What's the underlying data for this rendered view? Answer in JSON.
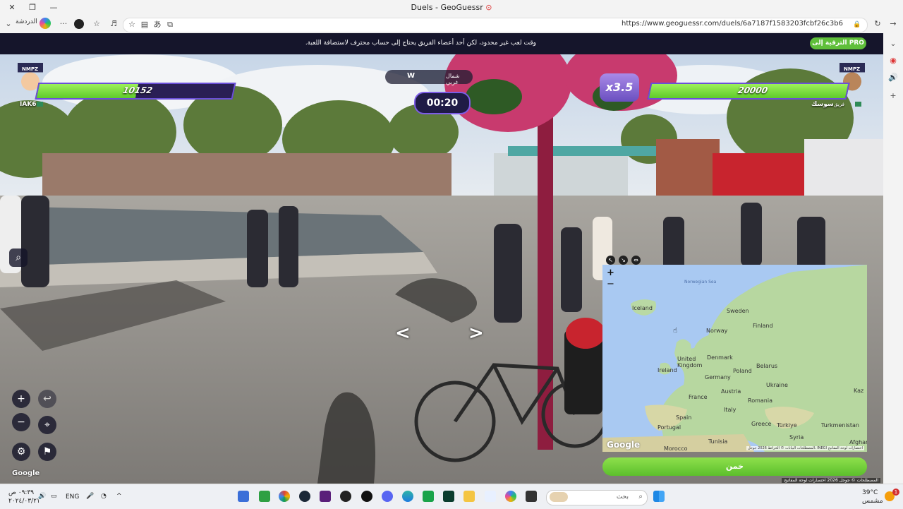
{
  "window": {
    "title": "Duels - GeoGuessr",
    "restore_glyph": "❐",
    "minimize_glyph": "—",
    "pin_glyph": "⊙"
  },
  "browser": {
    "url": "https://www.geoguessr.com/duels/6a7187f1583203fcbf26c3b6",
    "chat_label": "الدردشة",
    "dropdown_glyph": "⌄",
    "more_glyph": "···",
    "star_glyph": "☆",
    "reload_glyph": "↻",
    "forward_glyph": "→",
    "tab_glyph": "⧉",
    "translate_glyph": "あ",
    "reader_glyph": "▤",
    "lock_glyph": "🔒"
  },
  "sidebar_icons": {
    "chevron": "⌄",
    "map_pin": "◉",
    "speaker": "🔊",
    "add": "+"
  },
  "banner": {
    "message": "وقت لعب غير محدود، لكن أحد أعضاء الفريق يحتاج إلى حساب محترف لاستضافة اللعبة.",
    "pro_button": "الترقية إلى PRO"
  },
  "hud": {
    "left_player": {
      "name": "IAK6",
      "health": 10152,
      "health_max": 20000,
      "avatar_label": "NMPZ"
    },
    "right_player": {
      "name": "سوسك",
      "tag": "فريق",
      "health": 20000,
      "health_max": 20000,
      "avatar_label": "NMPZ"
    },
    "compass_w": "W",
    "compass_label": "شمال غربي",
    "timer": "00:20",
    "multiplier": "x3.5",
    "nav_left": "<",
    "nav_right": ">"
  },
  "controls": {
    "zoom_in": "+",
    "zoom_out": "−",
    "undo": "↩",
    "checkpoint": "⌖",
    "settings": "⚙",
    "flag": "⚑",
    "screenshot": "⌕"
  },
  "google_watermark": "Google",
  "map": {
    "tools": [
      "↖",
      "↘",
      "⇔"
    ],
    "zoom_in": "+",
    "zoom_out": "−",
    "labels": {
      "norwegian_sea": "Norwegian Sea",
      "iceland": "Iceland",
      "sweden": "Sweden",
      "norway": "Norway",
      "finland": "Finland",
      "united_kingdom": "United Kingdom",
      "ireland": "Ireland",
      "denmark": "Denmark",
      "belarus": "Belarus",
      "poland": "Poland",
      "germany": "Germany",
      "ukraine": "Ukraine",
      "austria": "Austria",
      "france": "France",
      "romania": "Romania",
      "italy": "Italy",
      "kazakhstan": "Kaz",
      "spain": "Spain",
      "greece": "Greece",
      "turkiye": "Türkiye",
      "turkmenistan": "Turkmenistan",
      "portugal": "Portugal",
      "syria": "Syria",
      "afghanistan": "Afghar",
      "tunisia": "Tunisia",
      "morocco": "Morocco"
    },
    "google": "Google",
    "attribution": "المصطلحات  البيانات © الخرائط 2026 جوجل، INEGI  اختصارات لوحة المفاتيح"
  },
  "guess_button": "خمن",
  "footer_attribution": "المصطلحات  © جوجل 2026  اختصارات لوحة المفاتيح",
  "taskbar": {
    "time": "٠٩:٣٩ ص",
    "date": "٢٠٢٤/٠٣/٢١",
    "lang": "ENG",
    "search_placeholder": "بحث",
    "search_glyph": "⌕",
    "weather_temp": "39°C",
    "weather_desc": "مشمس",
    "notification_count": "1",
    "tray_icons": {
      "expand": "^",
      "wifi": "◔",
      "speaker": "🔊",
      "mic": "🎤",
      "battery": "▭"
    }
  },
  "colors": {
    "accent_purple": "#6b4fd8",
    "health_green": "#5ecb2a",
    "banner_bg": "#15152b"
  }
}
